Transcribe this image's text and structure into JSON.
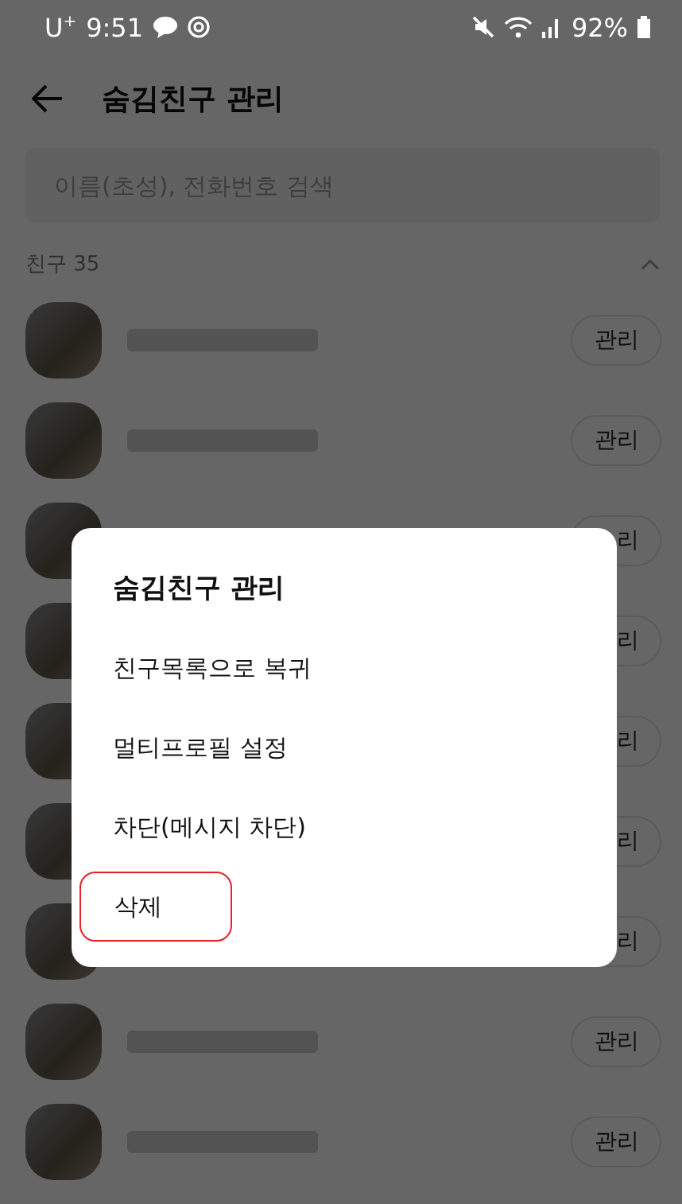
{
  "status_bar": {
    "carrier": "U$^{+}$",
    "time": "9:51",
    "battery": "92%"
  },
  "header": {
    "title": "숨김친구 관리"
  },
  "search": {
    "placeholder": "이름(초성), 전화번호 검색"
  },
  "section": {
    "label": "친구 35",
    "expanded": true
  },
  "rows": [
    {
      "button": "관리"
    },
    {
      "button": "관리"
    },
    {
      "button": "리"
    },
    {
      "button": "리"
    },
    {
      "button": "리"
    },
    {
      "button": "리"
    },
    {
      "button": "리"
    },
    {
      "button": "관리"
    },
    {
      "button": "관리"
    }
  ],
  "dialog": {
    "title": "숨김친구 관리",
    "items": [
      {
        "label": "친구목록으로 복귀",
        "highlighted": false
      },
      {
        "label": "멀티프로필 설정",
        "highlighted": false
      },
      {
        "label": "차단(메시지 차단)",
        "highlighted": false
      },
      {
        "label": "삭제",
        "highlighted": true
      }
    ]
  }
}
